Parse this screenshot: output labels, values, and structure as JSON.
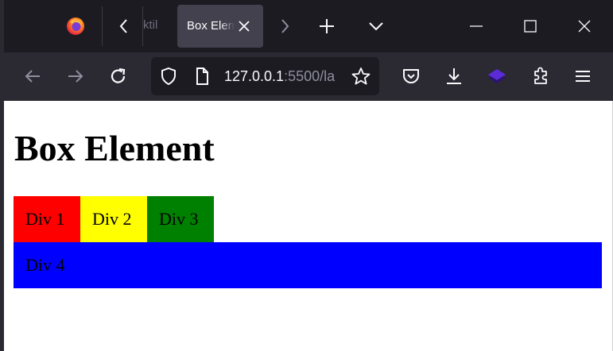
{
  "browser": {
    "tabs": [
      {
        "label": "ktil",
        "active": false
      },
      {
        "label": "Box Element",
        "active": true
      }
    ],
    "url": {
      "host": "127.0.0.1",
      "rest": ":5500/la"
    }
  },
  "page": {
    "title": "Box Element",
    "boxes": [
      {
        "label": "Div 1",
        "color": "#ff0000"
      },
      {
        "label": "Div 2",
        "color": "#ffff00"
      },
      {
        "label": "Div 3",
        "color": "#008000"
      },
      {
        "label": "Div 4",
        "color": "#0000ff"
      }
    ]
  },
  "colors": {
    "tabbar": "#1c1b22",
    "toolbar": "#2b2a33",
    "active_tab": "#42414d",
    "extension_accent": "#5b2bd8"
  }
}
